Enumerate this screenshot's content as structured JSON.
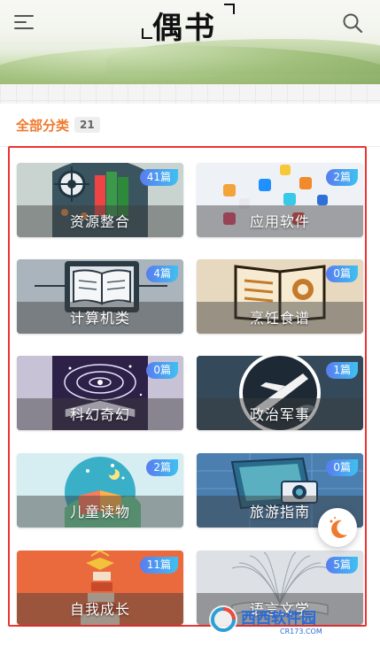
{
  "header": {
    "logo_text": "偶书"
  },
  "section": {
    "title": "全部分类",
    "count": "21"
  },
  "categories": [
    {
      "name": "资源整合",
      "count": "41篇"
    },
    {
      "name": "应用软件",
      "count": "2篇"
    },
    {
      "name": "计算机类",
      "count": "4篇"
    },
    {
      "name": "烹饪食谱",
      "count": "0篇"
    },
    {
      "name": "科幻奇幻",
      "count": "0篇"
    },
    {
      "name": "政治军事",
      "count": "1篇"
    },
    {
      "name": "儿童读物",
      "count": "2篇"
    },
    {
      "name": "旅游指南",
      "count": "0篇"
    },
    {
      "name": "自我成长",
      "count": "11篇"
    },
    {
      "name": "语言文学",
      "count": "5篇"
    }
  ],
  "watermark": {
    "text": "西西软件园",
    "sub": "CR173.COM"
  },
  "colors": {
    "accent": "#ef7a2e",
    "badge_start": "#5a7cf0",
    "badge_end": "#3fc0f0",
    "highlight_border": "#ee3333"
  }
}
